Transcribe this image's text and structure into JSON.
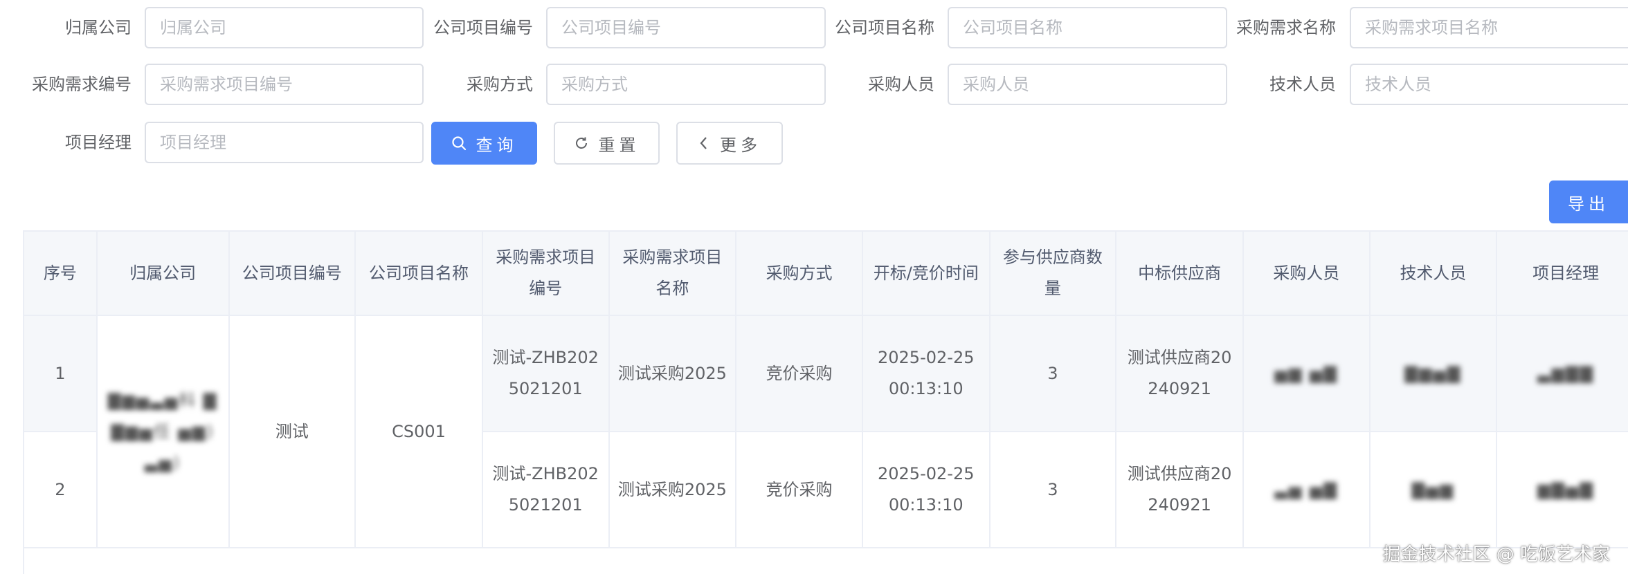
{
  "filters": {
    "company": {
      "label": "归属公司",
      "placeholder": "归属公司"
    },
    "project_no": {
      "label": "公司项目编号",
      "placeholder": "公司项目编号"
    },
    "project_name": {
      "label": "公司项目名称",
      "placeholder": "公司项目名称"
    },
    "demand_name": {
      "label": "采购需求名称",
      "placeholder": "采购需求项目名称"
    },
    "demand_no": {
      "label": "采购需求编号",
      "placeholder": "采购需求项目编号"
    },
    "method": {
      "label": "采购方式",
      "placeholder": "采购方式"
    },
    "buyer": {
      "label": "采购人员",
      "placeholder": "采购人员"
    },
    "tech": {
      "label": "技术人员",
      "placeholder": "技术人员"
    },
    "manager": {
      "label": "项目经理",
      "placeholder": "项目经理"
    }
  },
  "buttons": {
    "search": "查询",
    "reset": "重置",
    "more": "更多",
    "export": "导出"
  },
  "colors": {
    "primary": "#4f86f7",
    "border": "#dcdfe6",
    "header_bg": "#f5f7fa"
  },
  "table": {
    "columns": [
      "序号",
      "归属公司",
      "公司项目编号",
      "公司项目名称",
      "采购需求项目编号",
      "采购需求项目名称",
      "采购方式",
      "开标/竞价时间",
      "参与供应商数量",
      "中标供应商",
      "采购人员",
      "技术人员",
      "项目经理"
    ],
    "merged": {
      "company": "▇▆▅▃▅科 ▇▇▆▅任 ▅▆) ▃▅)",
      "project_no": "测试",
      "project_name": "CS001"
    },
    "rows": [
      {
        "index": "1",
        "demand_no": "测试-ZHB2025021201",
        "demand_name": "测试采购2025",
        "method": "竞价采购",
        "time": "2025-02-25 00:13:10",
        "supplier_count": "3",
        "winner": "测试供应商20240921",
        "buyer": "▅▆ ▅▇",
        "tech": "▇▆▅▇",
        "manager": "▃▆▇▇"
      },
      {
        "index": "2",
        "demand_no": "测试-ZHB2025021201",
        "demand_name": "测试采购2025",
        "method": "竞价采购",
        "time": "2025-02-25 00:13:10",
        "supplier_count": "3",
        "winner": "测试供应商20240921",
        "buyer": "▃▅ ▅▇",
        "tech": "▇▅▆",
        "manager": "▆▇▅▇"
      }
    ]
  },
  "watermark": "掘金技术社区 @ 吃饭艺术家"
}
